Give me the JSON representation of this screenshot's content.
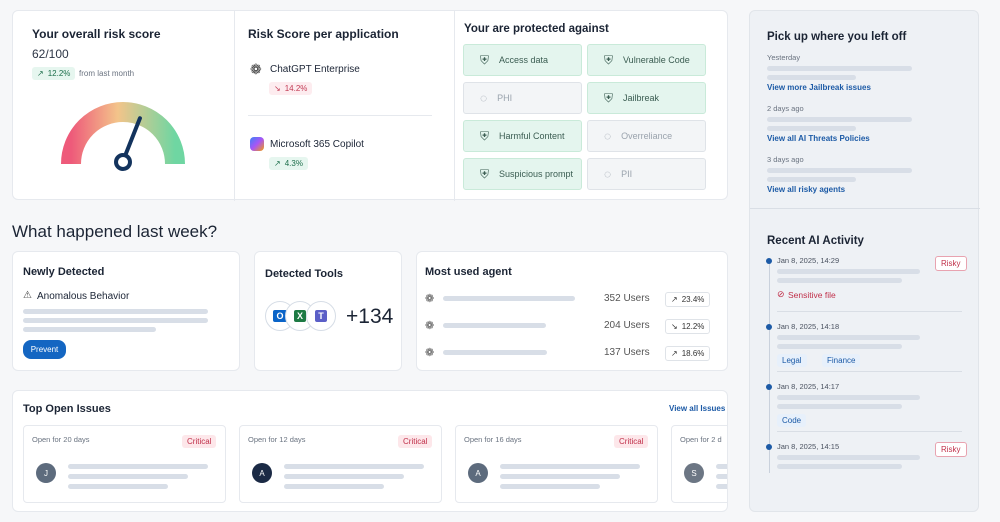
{
  "risk": {
    "title": "Your overall risk score",
    "score": "62/100",
    "change": "12.2%",
    "from": "from last month",
    "gauge_value": 62
  },
  "apps": {
    "title": "Risk Score per application",
    "items": [
      {
        "name": "ChatGPT Enterprise",
        "change": "14.2%",
        "dir": "down"
      },
      {
        "name": "Microsoft 365 Copilot",
        "change": "4.3%",
        "dir": "up"
      }
    ]
  },
  "protected": {
    "title": "Your are protected against",
    "items": [
      {
        "label": "Access data",
        "on": true
      },
      {
        "label": "Vulnerable Code",
        "on": true
      },
      {
        "label": "PHI",
        "on": false
      },
      {
        "label": "Jailbreak",
        "on": true
      },
      {
        "label": "Harmful Content",
        "on": true
      },
      {
        "label": "Overreliance",
        "on": false
      },
      {
        "label": "Suspicious prompt",
        "on": true
      },
      {
        "label": "PII",
        "on": false
      }
    ]
  },
  "week_title": "What happened last week?",
  "newly": {
    "title": "Newly Detected",
    "item": "Anomalous Behavior",
    "button": "Prevent"
  },
  "tools": {
    "title": "Detected Tools",
    "count": "+134",
    "icons": [
      "outlook-icon",
      "excel-icon",
      "teams-icon"
    ]
  },
  "agents": {
    "title": "Most used agent",
    "rows": [
      {
        "users": "352 Users",
        "change": "23.4%",
        "dir": "up"
      },
      {
        "users": "204 Users",
        "change": "12.2%",
        "dir": "down"
      },
      {
        "users": "137 Users",
        "change": "18.6%",
        "dir": "up"
      }
    ]
  },
  "issues": {
    "title": "Top Open Issues",
    "view_all": "View all Issues",
    "cards": [
      {
        "open": "Open for 20 days",
        "sev": "Critical",
        "avatar": "J",
        "color": "#5d6b7d"
      },
      {
        "open": "Open for 12 days",
        "sev": "Critical",
        "avatar": "A",
        "color": "#1b2a45"
      },
      {
        "open": "Open for 16 days",
        "sev": "Critical",
        "avatar": "A",
        "color": "#5d6b7d"
      },
      {
        "open": "Open for 2 d",
        "sev": "",
        "avatar": "S",
        "color": "#6c7684"
      }
    ]
  },
  "pickup": {
    "title": "Pick up where you left off",
    "entries": [
      {
        "when": "Yesterday",
        "link": "View more Jailbreak issues"
      },
      {
        "when": "2 days ago",
        "link": "View all AI Threats Policies"
      },
      {
        "when": "3 days ago",
        "link": "View all risky agents"
      }
    ]
  },
  "activity": {
    "title": "Recent AI Activity",
    "entries": [
      {
        "date": "Jan 8, 2025, 14:29",
        "badge": "Risky",
        "extra": "Sensitive file"
      },
      {
        "date": "Jan 8, 2025, 14:18",
        "tags": [
          "Legal",
          "Finance"
        ]
      },
      {
        "date": "Jan 8, 2025, 14:17",
        "tags": [
          "Code"
        ]
      },
      {
        "date": "Jan 8, 2025, 14:15",
        "badge": "Risky"
      }
    ]
  },
  "colors": {
    "accent": "#1c5aa6",
    "positive": "#1c6e4a",
    "negative": "#c23a54"
  }
}
